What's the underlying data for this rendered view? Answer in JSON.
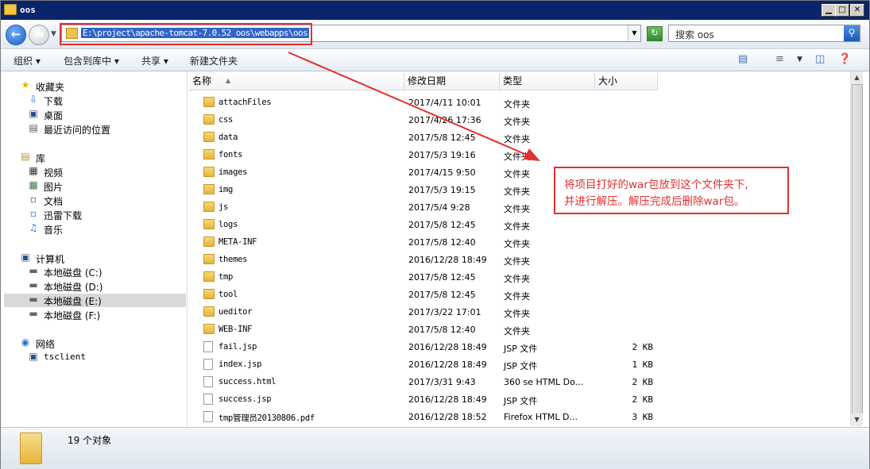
{
  "window": {
    "title": "oos",
    "controls": {
      "minimize": "▁",
      "maximize": "□",
      "close": "✕"
    }
  },
  "address": {
    "path": "E:\\project\\apache-tomcat-7.0.52_oos\\webapps\\oos",
    "search_placeholder": "搜索 oos"
  },
  "toolbar": {
    "organize": "组织",
    "include_library": "包含到库中",
    "share": "共享",
    "new_folder": "新建文件夹"
  },
  "sidebar": {
    "favorites": {
      "label": "收藏夹",
      "items": [
        "下载",
        "桌面",
        "最近访问的位置"
      ]
    },
    "libraries": {
      "label": "库",
      "items": [
        "视频",
        "图片",
        "文档",
        "迅雷下载",
        "音乐"
      ]
    },
    "computer": {
      "label": "计算机",
      "items": [
        "本地磁盘 (C:)",
        "本地磁盘 (D:)",
        "本地磁盘 (E:)",
        "本地磁盘 (F:)"
      ]
    },
    "network": {
      "label": "网络",
      "items": [
        "tsclient"
      ]
    }
  },
  "columns": {
    "name": "名称",
    "date": "修改日期",
    "type": "类型",
    "size": "大小"
  },
  "files": [
    {
      "name": "attachFiles",
      "date": "2017/4/11 10:01",
      "type": "文件夹",
      "size": "",
      "kind": "folder"
    },
    {
      "name": "css",
      "date": "2017/4/26 17:36",
      "type": "文件夹",
      "size": "",
      "kind": "folder"
    },
    {
      "name": "data",
      "date": "2017/5/8 12:45",
      "type": "文件夹",
      "size": "",
      "kind": "folder"
    },
    {
      "name": "fonts",
      "date": "2017/5/3 19:16",
      "type": "文件夹",
      "size": "",
      "kind": "folder"
    },
    {
      "name": "images",
      "date": "2017/4/15 9:50",
      "type": "文件夹",
      "size": "",
      "kind": "folder"
    },
    {
      "name": "img",
      "date": "2017/5/3 19:15",
      "type": "文件夹",
      "size": "",
      "kind": "folder"
    },
    {
      "name": "js",
      "date": "2017/5/4 9:28",
      "type": "文件夹",
      "size": "",
      "kind": "folder"
    },
    {
      "name": "logs",
      "date": "2017/5/8 12:45",
      "type": "文件夹",
      "size": "",
      "kind": "folder"
    },
    {
      "name": "META-INF",
      "date": "2017/5/8 12:40",
      "type": "文件夹",
      "size": "",
      "kind": "folder"
    },
    {
      "name": "themes",
      "date": "2016/12/28 18:49",
      "type": "文件夹",
      "size": "",
      "kind": "folder"
    },
    {
      "name": "tmp",
      "date": "2017/5/8 12:45",
      "type": "文件夹",
      "size": "",
      "kind": "folder"
    },
    {
      "name": "tool",
      "date": "2017/5/8 12:45",
      "type": "文件夹",
      "size": "",
      "kind": "folder"
    },
    {
      "name": "ueditor",
      "date": "2017/3/22 17:01",
      "type": "文件夹",
      "size": "",
      "kind": "folder"
    },
    {
      "name": "WEB-INF",
      "date": "2017/5/8 12:40",
      "type": "文件夹",
      "size": "",
      "kind": "folder"
    },
    {
      "name": "fail.jsp",
      "date": "2016/12/28 18:49",
      "type": "JSP 文件",
      "size": "2 KB",
      "kind": "doc"
    },
    {
      "name": "index.jsp",
      "date": "2016/12/28 18:49",
      "type": "JSP 文件",
      "size": "1 KB",
      "kind": "doc"
    },
    {
      "name": "success.html",
      "date": "2017/3/31 9:43",
      "type": "360 se HTML Do...",
      "size": "2 KB",
      "kind": "doc"
    },
    {
      "name": "success.jsp",
      "date": "2016/12/28 18:49",
      "type": "JSP 文件",
      "size": "2 KB",
      "kind": "doc"
    },
    {
      "name": "tmp管理员20130806.pdf",
      "date": "2016/12/28 18:52",
      "type": "Firefox HTML D...",
      "size": "3 KB",
      "kind": "doc"
    }
  ],
  "status": {
    "count": "19 个对象"
  },
  "annotation": {
    "line1": "将项目打好的war包放到这个文件夹下,",
    "line2": "并进行解压。解压完成后删除war包。"
  },
  "colors": {
    "annotation": "#e33030",
    "titlebar": "#0a246a",
    "selection": "#3065c8"
  }
}
